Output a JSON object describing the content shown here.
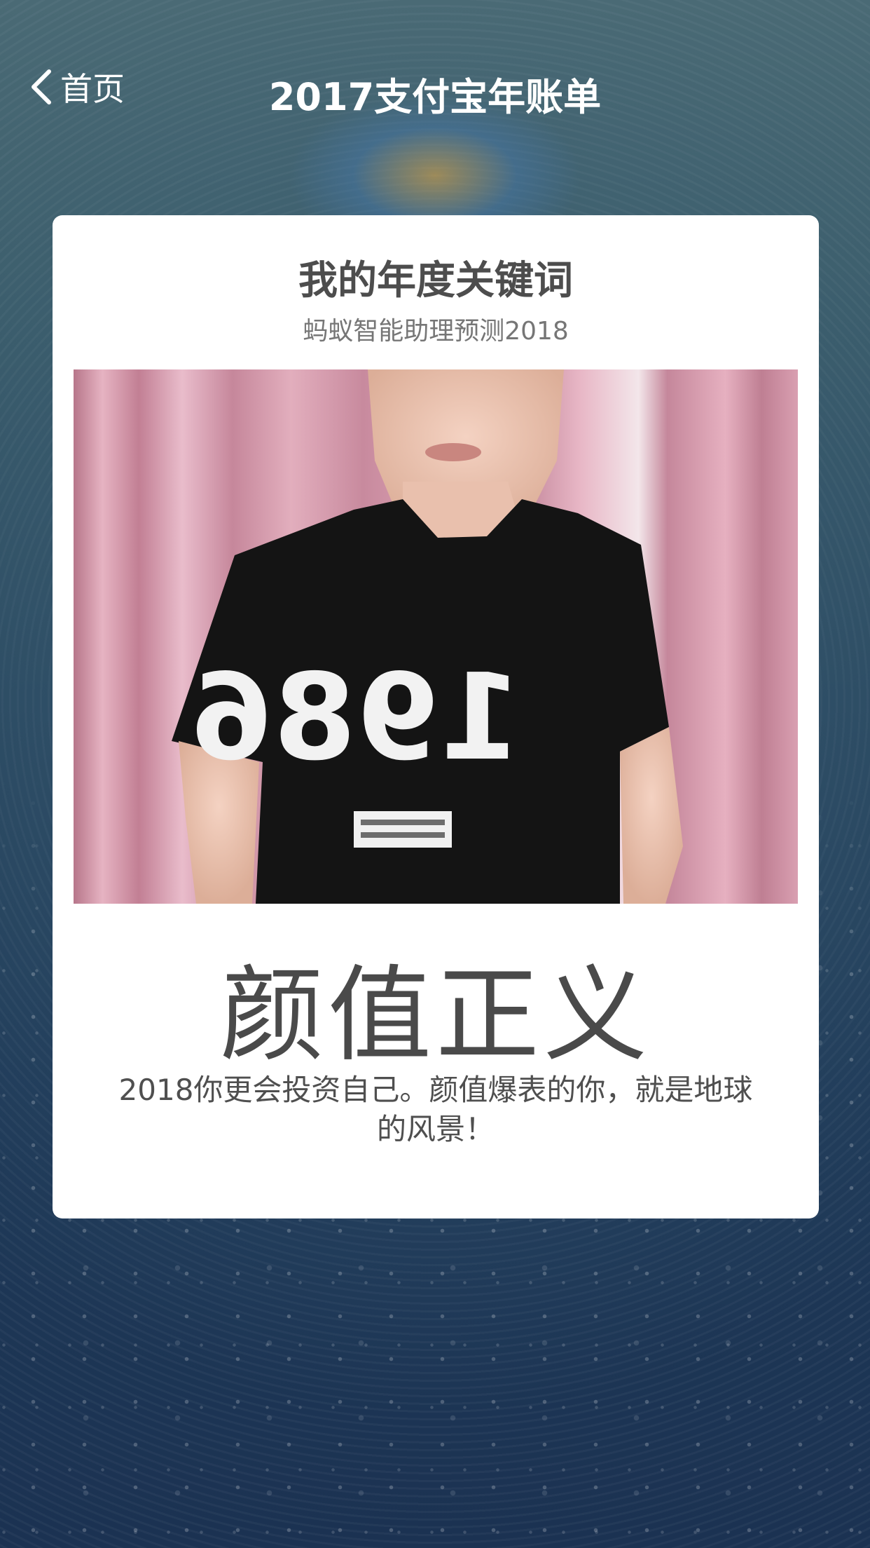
{
  "nav": {
    "back_label": "首页",
    "title": "2017支付宝年账单"
  },
  "card": {
    "title": "我的年度关键词",
    "subtitle": "蚂蚁智能助理预测2018",
    "keyword": "颜值正义",
    "description": "2018你更会投资自己。颜值爆表的你，就是地球的风景！",
    "photo": {
      "shirt_print": "1986"
    }
  },
  "colors": {
    "card_bg": "#ffffff",
    "title_text": "#4d4d4d",
    "subtitle_text": "#767676",
    "nav_text": "#ffffff",
    "curtain": "#c98a9e",
    "shirt": "#141414"
  }
}
